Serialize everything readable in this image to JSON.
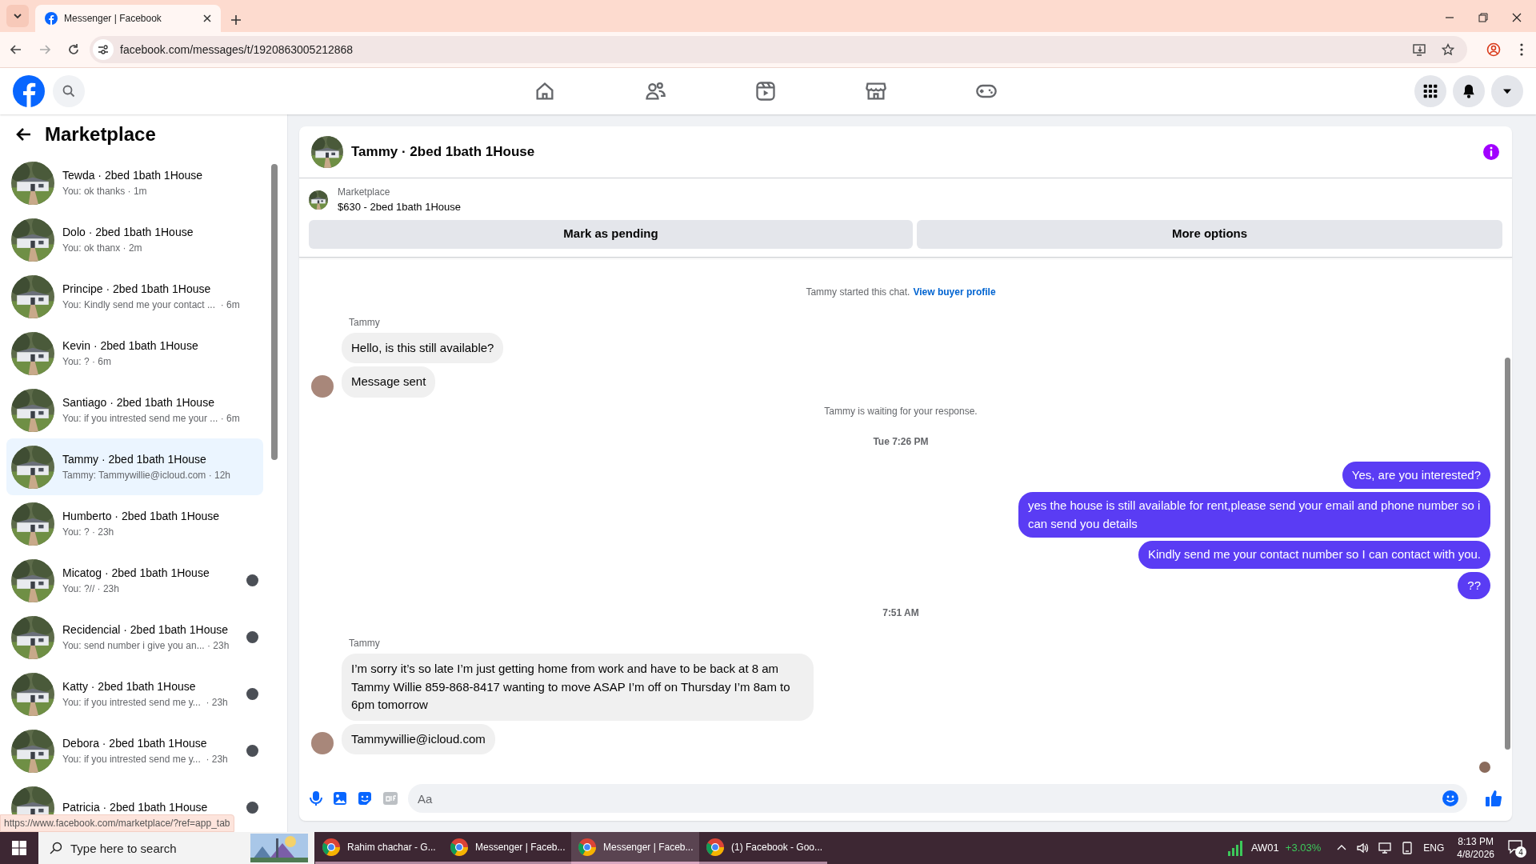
{
  "browser": {
    "tabs": [
      {
        "title": "Messenger | Facebook",
        "selected": true
      }
    ],
    "url": "facebook.com/messages/t/1920863005212868"
  },
  "sidebar": {
    "title": "Marketplace",
    "conversations": [
      {
        "name": "Tewda · 2bed 1bath 1House",
        "meta": "You: ok thanks · 1m",
        "selected": false,
        "seen": false
      },
      {
        "name": "Dolo · 2bed 1bath 1House",
        "meta": "You: ok thanx · 2m",
        "selected": false,
        "seen": false
      },
      {
        "name": "Principe · 2bed 1bath 1House",
        "meta": "You: Kindly send me your contact ...  · 6m",
        "selected": false,
        "seen": false
      },
      {
        "name": "Kevin · 2bed 1bath 1House",
        "meta": "You: ? · 6m",
        "selected": false,
        "seen": false
      },
      {
        "name": "Santiago · 2bed 1bath 1House",
        "meta": "You: if you intrested send me your ... · 6m",
        "selected": false,
        "seen": false
      },
      {
        "name": "Tammy · 2bed 1bath 1House",
        "meta": "Tammy: Tammywillie@icloud.com · 12h",
        "selected": true,
        "seen": false
      },
      {
        "name": "Humberto · 2bed 1bath 1House",
        "meta": "You: ? · 23h",
        "selected": false,
        "seen": false
      },
      {
        "name": "Micatog · 2bed 1bath 1House",
        "meta": "You: ?// · 23h",
        "selected": false,
        "seen": true
      },
      {
        "name": "Recidencial · 2bed 1bath 1House",
        "meta": "You: send number i give you an... · 23h",
        "selected": false,
        "seen": true
      },
      {
        "name": "Katty · 2bed 1bath 1House",
        "meta": "You: if you intrested send me y...  · 23h",
        "selected": false,
        "seen": true
      },
      {
        "name": "Debora · 2bed 1bath 1House",
        "meta": "You: if you intrested send me y...  · 23h",
        "selected": false,
        "seen": true
      },
      {
        "name": "Patricia · 2bed 1bath 1House",
        "selected": false,
        "seen": true
      }
    ]
  },
  "status_url": "https://www.facebook.com/marketplace/?ref=app_tab",
  "chat": {
    "title": "Tammy · 2bed 1bath 1House",
    "listing_label": "Marketplace",
    "listing": "$630 - 2bed 1bath 1House",
    "buttons": [
      "Mark as pending",
      "More options"
    ],
    "messages": [
      {
        "kind": "notice",
        "text": "Tammy started this chat.",
        "link": "View buyer profile"
      },
      {
        "kind": "sender",
        "text": "Tammy"
      },
      {
        "kind": "incoming",
        "text": "Hello, is this still available?",
        "avatar": false
      },
      {
        "kind": "incoming",
        "text": "Message sent",
        "avatar": true
      },
      {
        "kind": "notice",
        "text": "Tammy is waiting for your response."
      },
      {
        "kind": "time",
        "text": "Tue 7:26 PM"
      },
      {
        "kind": "outgoing",
        "text": "Yes, are you interested?"
      },
      {
        "kind": "outgoing",
        "text": "yes the house is still available for rent,please send your email and phone number so i can send you details"
      },
      {
        "kind": "outgoing",
        "text": "Kindly send me your contact number so I can contact with you."
      },
      {
        "kind": "outgoing",
        "text": "??"
      },
      {
        "kind": "time",
        "text": "7:51 AM"
      },
      {
        "kind": "sender",
        "text": "Tammy"
      },
      {
        "kind": "incoming",
        "text": "I’m sorry it’s so late I’m just getting home from work and have to be back at 8 am Tammy Willie 859-868-8417 wanting to move ASAP I’m off on Thursday I’m 8am to 6pm tomorrow",
        "avatar": false
      },
      {
        "kind": "incoming",
        "text": "Tammywillie@icloud.com",
        "avatar": true
      }
    ],
    "composer": {
      "placeholder": "Aa"
    }
  },
  "taskbar": {
    "search": {
      "placeholder": "Type here to search"
    },
    "apps": [
      {
        "title": "Rahim chachar - G...",
        "selected": false
      },
      {
        "title": "Messenger | Faceb...",
        "selected": false
      },
      {
        "title": "Messenger | Faceb...",
        "selected": true
      },
      {
        "title": "(1) Facebook - Goo...",
        "selected": false
      }
    ],
    "ticker": "AW01",
    "change": "+3.03%",
    "lang": "ENG",
    "time": "8:13 PM",
    "date": "4/8/2026",
    "notifications": "4"
  }
}
